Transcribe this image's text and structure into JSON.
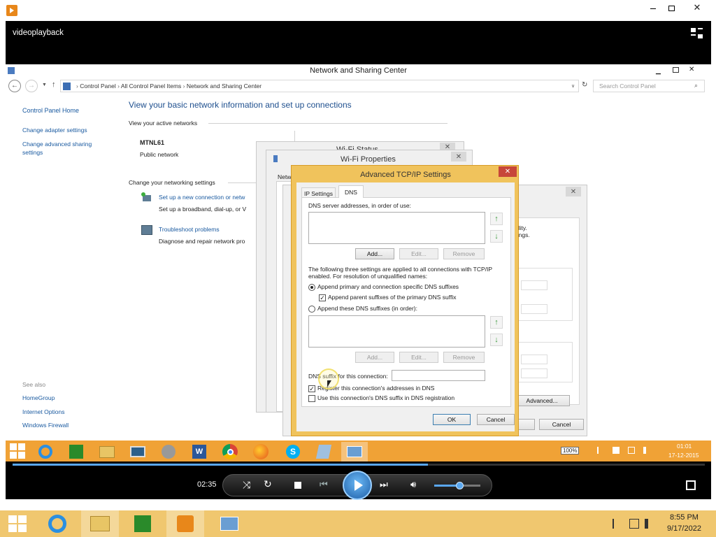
{
  "player": {
    "title": "videoplayback",
    "time": "02:35",
    "progress": 0.6,
    "volume": 0.55
  },
  "network_window": {
    "title": "Network and Sharing Center",
    "breadcrumb": [
      "Control Panel",
      "All Control Panel Items",
      "Network and Sharing Center"
    ],
    "search_placeholder": "Search Control Panel",
    "sidebar": {
      "home": "Control Panel Home",
      "links": [
        "Change adapter settings",
        "Change advanced sharing settings"
      ],
      "see_also_title": "See also",
      "see_also": [
        "HomeGroup",
        "Internet Options",
        "Windows Firewall"
      ]
    },
    "heading": "View your basic network information and set up connections",
    "active_networks_label": "View your active networks",
    "network_name": "MTNL61",
    "network_type": "Public network",
    "change_settings_label": "Change your networking settings",
    "tasks": [
      {
        "title": "Set up a new connection or netw",
        "desc": "Set up a broadband, dial-up, or V"
      },
      {
        "title": "Troubleshoot problems",
        "desc": "Diagnose and repair network pro"
      }
    ]
  },
  "wifi_status": {
    "title": "Wi-Fi Status"
  },
  "wifi_props": {
    "title": "Wi-Fi Properties",
    "tab": "Netw"
  },
  "ipv4_dialog": {
    "text1": "bility.",
    "text2": "ttings.",
    "advanced_btn": "Advanced...",
    "cancel_btn": "Cancel"
  },
  "tcpip": {
    "title": "Advanced TCP/IP Settings",
    "tabs": [
      "IP Settings",
      "DNS"
    ],
    "dns_servers_label": "DNS server addresses, in order of use:",
    "add": "Add...",
    "edit": "Edit...",
    "remove": "Remove",
    "info_line1": "The following three settings are applied to all connections with TCP/IP",
    "info_line2": "enabled. For resolution of unqualified names:",
    "radio1": "Append primary and connection specific DNS suffixes",
    "check_parent": "Append parent suffixes of the primary DNS suffix",
    "radio2": "Append these DNS suffixes (in order):",
    "suffix_label": "DNS suffix for this connection:",
    "suffix_value": "",
    "register": "Register this connection's addresses in DNS",
    "use_suffix": "Use this connection's DNS suffix in DNS registration",
    "ok": "OK",
    "cancel": "Cancel"
  },
  "inner_taskbar": {
    "battery": "100%",
    "time": "01:01",
    "date": "17-12-2015"
  },
  "outer_taskbar": {
    "time": "8:55 PM",
    "date": "9/17/2022"
  }
}
